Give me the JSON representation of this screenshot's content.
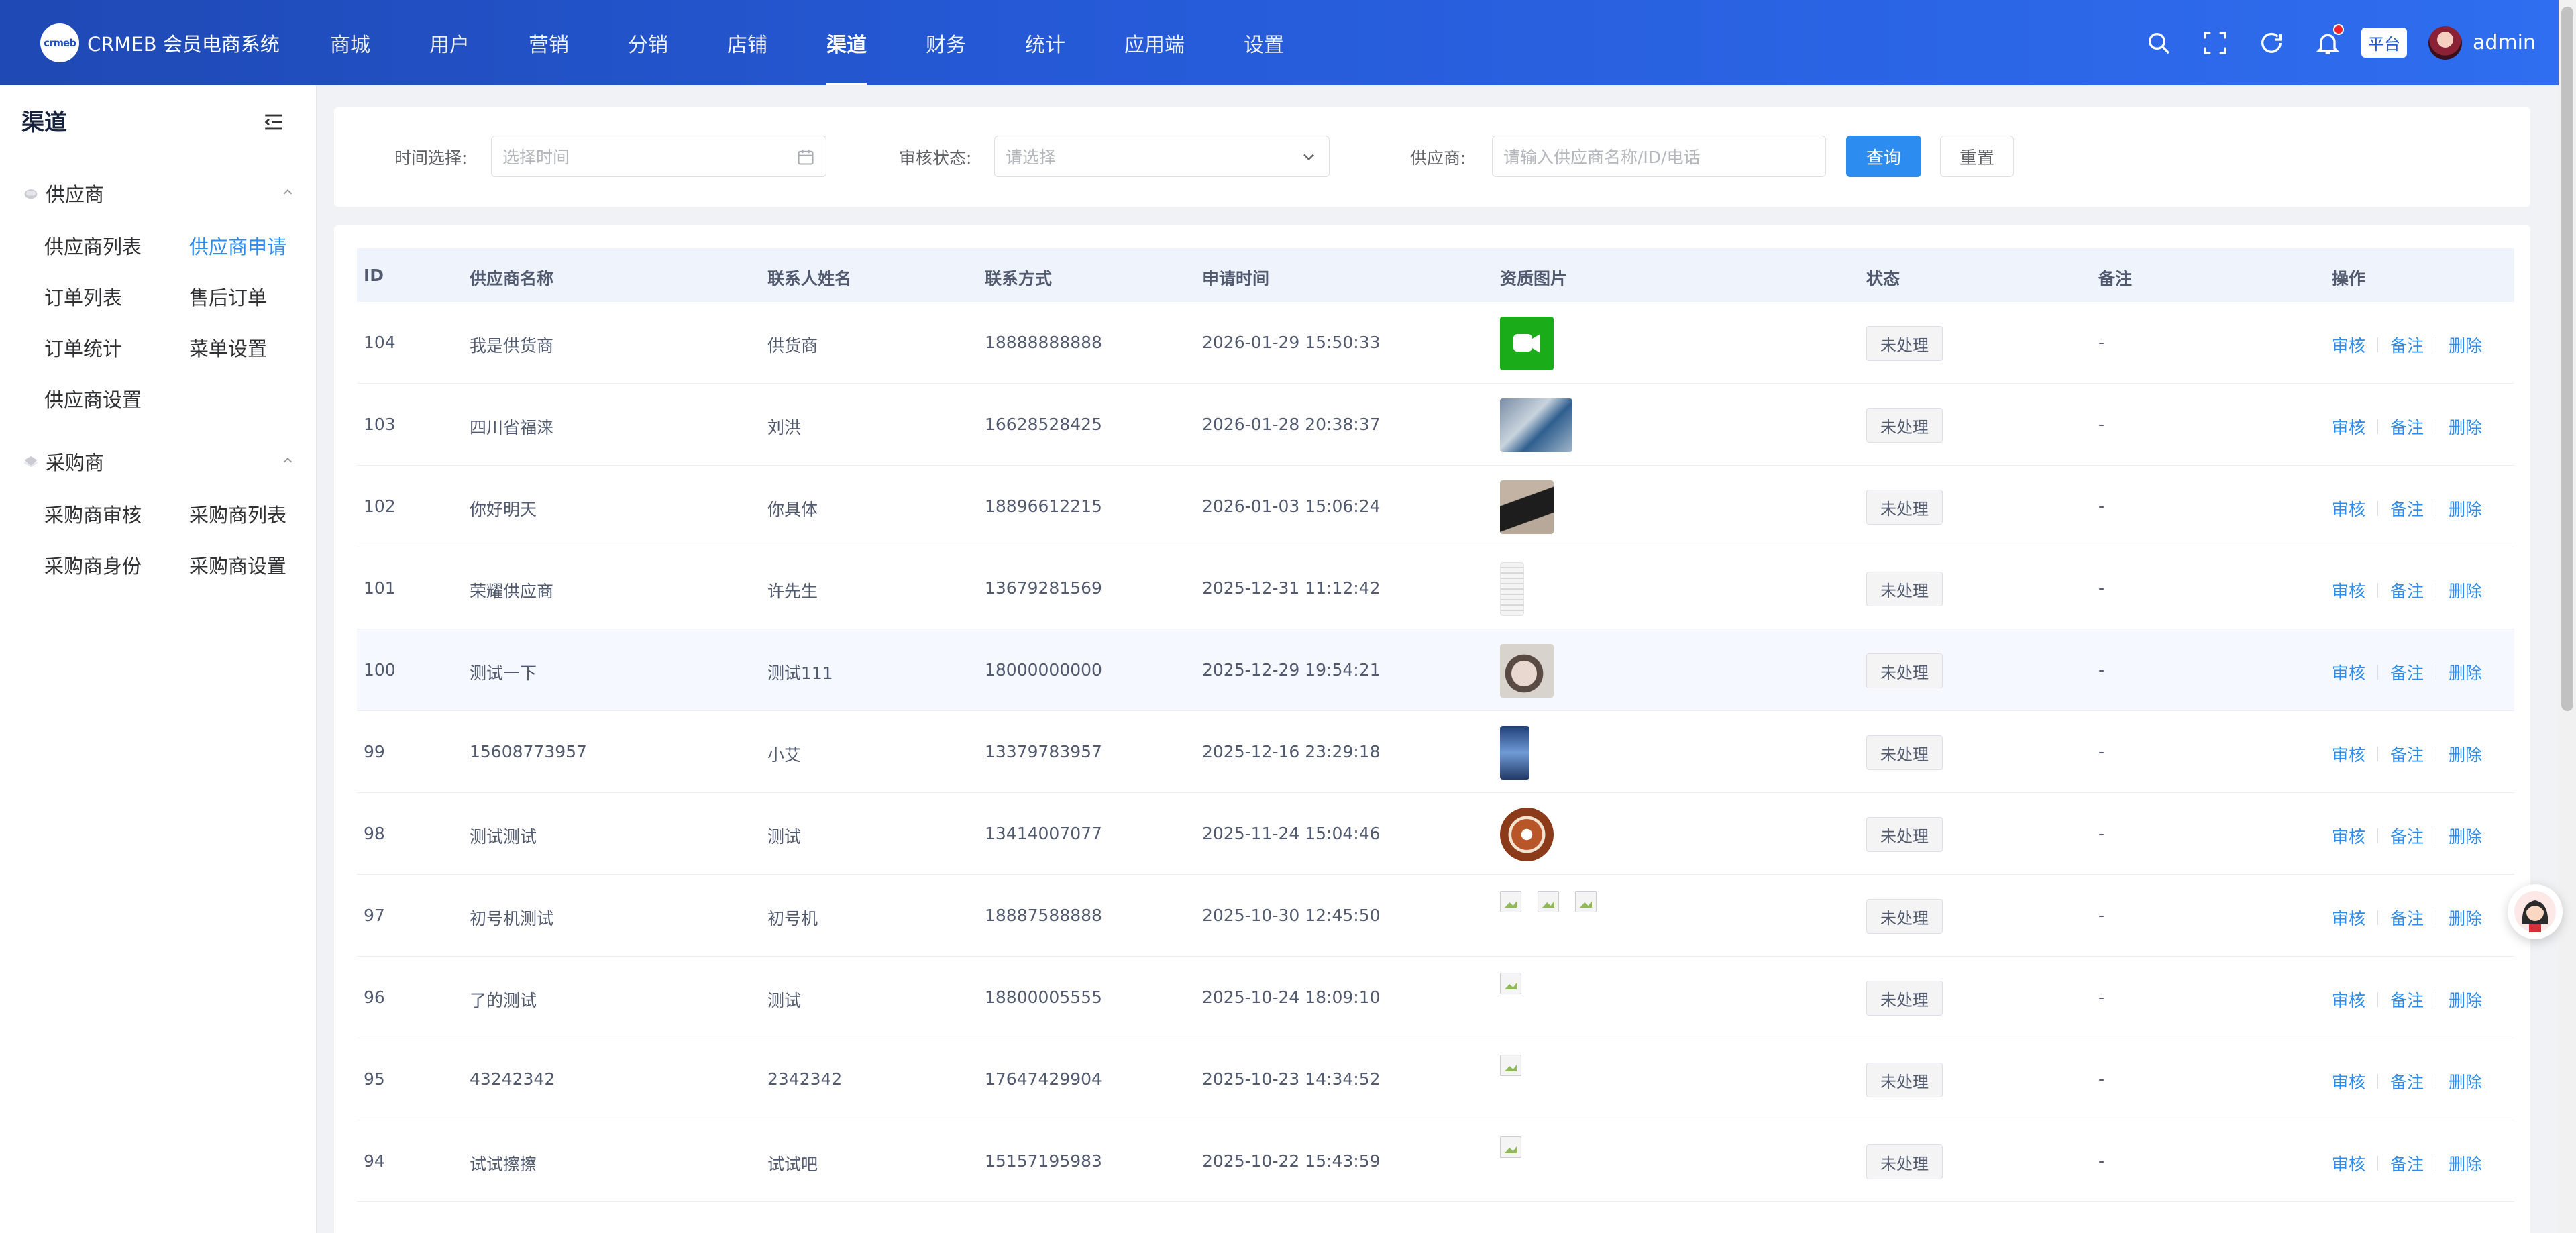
{
  "app": {
    "logo_text": "crmeb",
    "name": "CRMEB 会员电商系统"
  },
  "topnav": [
    {
      "label": "商城"
    },
    {
      "label": "用户"
    },
    {
      "label": "营销"
    },
    {
      "label": "分销"
    },
    {
      "label": "店铺"
    },
    {
      "label": "渠道",
      "active": true
    },
    {
      "label": "财务"
    },
    {
      "label": "统计"
    },
    {
      "label": "应用端"
    },
    {
      "label": "设置"
    }
  ],
  "header_tools": {
    "platform_tag": "平台",
    "admin_name": "admin",
    "icons": [
      "search-icon",
      "fullscreen-icon",
      "refresh-icon",
      "bell-icon"
    ]
  },
  "sidebar": {
    "title": "渠道",
    "groups": [
      {
        "label": "供应商",
        "icon": "supplier-icon",
        "items": [
          "供应商列表",
          "供应商申请",
          "订单列表",
          "售后订单",
          "订单统计",
          "菜单设置",
          "供应商设置"
        ],
        "active": "供应商申请"
      },
      {
        "label": "采购商",
        "icon": "purchaser-icon",
        "items": [
          "采购商审核",
          "采购商列表",
          "采购商身份",
          "采购商设置"
        ]
      }
    ]
  },
  "filters": {
    "time_label": "时间选择:",
    "time_placeholder": "选择时间",
    "status_label": "审核状态:",
    "status_placeholder": "请选择",
    "supplier_label": "供应商:",
    "supplier_placeholder": "请输入供应商名称/ID/电话",
    "query_button": "查询",
    "reset_button": "重置"
  },
  "table": {
    "columns": [
      "ID",
      "供应商名称",
      "联系人姓名",
      "联系方式",
      "申请时间",
      "资质图片",
      "状态",
      "备注",
      "操作"
    ],
    "actions": [
      "审核",
      "备注",
      "删除"
    ],
    "rows": [
      {
        "id": "104",
        "name": "我是供货商",
        "contact": "供货商",
        "phone": "18888888888",
        "time": "2026-01-29 15:50:33",
        "status": "未处理",
        "remark": "-",
        "image": "wechat"
      },
      {
        "id": "103",
        "name": "四川省福涞",
        "contact": "刘洪",
        "phone": "16628528425",
        "time": "2026-01-28 20:38:37",
        "status": "未处理",
        "remark": "-",
        "image": "board"
      },
      {
        "id": "102",
        "name": "你好明天",
        "contact": "你具体",
        "phone": "18896612215",
        "time": "2026-01-03 15:06:24",
        "status": "未处理",
        "remark": "-",
        "image": "leg"
      },
      {
        "id": "101",
        "name": "荣耀供应商",
        "contact": "许先生",
        "phone": "13679281569",
        "time": "2025-12-31 11:12:42",
        "status": "未处理",
        "remark": "-",
        "image": "doc"
      },
      {
        "id": "100",
        "name": "测试一下",
        "contact": "测试111",
        "phone": "18000000000",
        "time": "2025-12-29 19:54:21",
        "status": "未处理",
        "remark": "-",
        "image": "face"
      },
      {
        "id": "99",
        "name": "15608773957",
        "contact": "小艾",
        "phone": "13379783957",
        "time": "2025-12-16 23:29:18",
        "status": "未处理",
        "remark": "-",
        "image": "phone"
      },
      {
        "id": "98",
        "name": "测试测试",
        "contact": "测试",
        "phone": "13414007077",
        "time": "2025-11-24 15:04:46",
        "status": "未处理",
        "remark": "-",
        "image": "compass"
      },
      {
        "id": "97",
        "name": "初号机测试",
        "contact": "初号机",
        "phone": "18887588888",
        "time": "2025-10-30 12:45:50",
        "status": "未处理",
        "remark": "-",
        "image": "broken3"
      },
      {
        "id": "96",
        "name": "了的测试",
        "contact": "测试",
        "phone": "18800005555",
        "time": "2025-10-24 18:09:10",
        "status": "未处理",
        "remark": "-",
        "image": "broken1"
      },
      {
        "id": "95",
        "name": "43242342",
        "contact": "2342342",
        "phone": "17647429904",
        "time": "2025-10-23 14:34:52",
        "status": "未处理",
        "remark": "-",
        "image": "broken1"
      },
      {
        "id": "94",
        "name": "试试擦擦",
        "contact": "试试吧",
        "phone": "15157195983",
        "time": "2025-10-22 15:43:59",
        "status": "未处理",
        "remark": "-",
        "image": "broken1"
      }
    ]
  },
  "colors": {
    "header_start": "#1f49b4",
    "header_end": "#2f6ef0",
    "link": "#2d8cf0",
    "table_head_bg": "#eef3fc"
  }
}
